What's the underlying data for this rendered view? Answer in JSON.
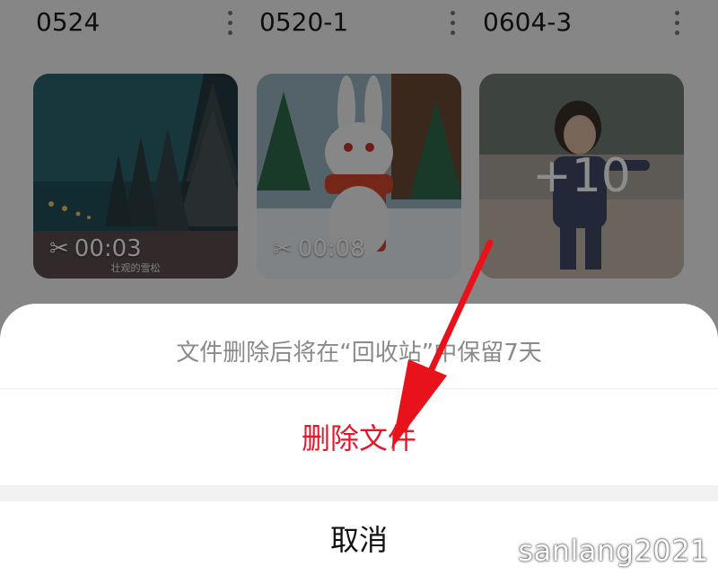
{
  "albums": [
    {
      "title": "0524",
      "duration": "00:03",
      "caption": "壮观的雪松"
    },
    {
      "title": "0520-1",
      "duration": "00:08"
    },
    {
      "title": "0604-3",
      "more_count": "+10"
    }
  ],
  "sheet": {
    "hint": "文件删除后将在“回收站”中保留7天",
    "delete_label": "删除文件",
    "cancel_label": "取消"
  },
  "watermark": "sanlang2021",
  "colors": {
    "destructive": "#e3192b",
    "arrow": "#e8121a"
  }
}
